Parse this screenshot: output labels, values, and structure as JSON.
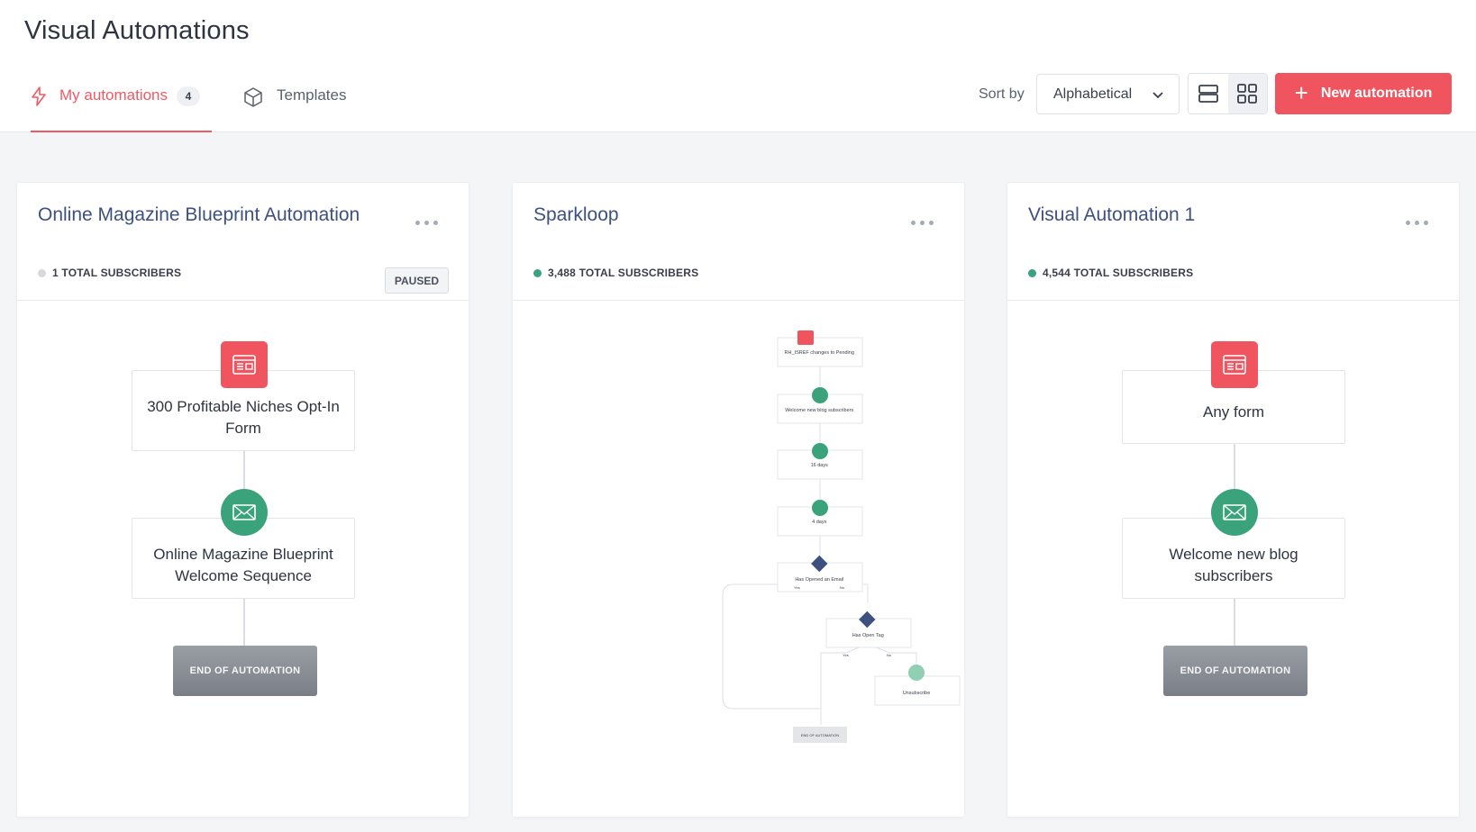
{
  "header": {
    "title": "Visual Automations",
    "tabs": [
      {
        "label": "My automations",
        "count": "4",
        "icon": "lightning-icon",
        "active": true
      },
      {
        "label": "Templates",
        "icon": "box-icon",
        "active": false
      }
    ],
    "sort_label": "Sort by",
    "sort_value": "Alphabetical",
    "view_modes": [
      "list-view-icon",
      "grid-view-icon"
    ],
    "active_view": "grid",
    "new_button": "New automation"
  },
  "colors": {
    "accent": "#f0555f",
    "active_dot": "#3aa37b",
    "inactive_dot": "#d5d8dd",
    "title": "#3d5080",
    "condition": "#3d5080"
  },
  "cards": [
    {
      "title": "Online Magazine Blueprint Automation",
      "subscribers": "1 TOTAL SUBSCRIBERS",
      "status_dot": "inactive",
      "badge": "PAUSED",
      "nodes": [
        {
          "type": "form",
          "icon": "form-icon",
          "label": "300 Profitable Niches Opt-In Form"
        },
        {
          "type": "email",
          "icon": "envelope-icon",
          "label": "Online Magazine Blueprint Welcome Sequence"
        }
      ],
      "end_label": "END OF AUTOMATION"
    },
    {
      "title": "Sparkloop",
      "subscribers": "3,488 TOTAL SUBSCRIBERS",
      "status_dot": "active",
      "flow": [
        {
          "type": "trigger",
          "icon": "tag-icon",
          "label": "RH_ISREF changes to Pending"
        },
        {
          "type": "email",
          "icon": "envelope-icon",
          "label": "Welcome new blog subscribers"
        },
        {
          "type": "delay",
          "icon": "clock-icon",
          "label": "16 days"
        },
        {
          "type": "delay",
          "icon": "clock-icon",
          "label": "4 days"
        },
        {
          "type": "condition",
          "icon": "branch-icon",
          "label": "Has Opened an Email"
        },
        {
          "type": "condition",
          "icon": "branch-icon",
          "label": "Has Open Tag"
        },
        {
          "type": "action",
          "icon": "unsubscribe-icon",
          "label": "Unsubscribe"
        }
      ],
      "branch_labels": {
        "yes": "Yes",
        "no": "No"
      },
      "end_label": "END OF AUTOMATION"
    },
    {
      "title": "Visual Automation 1",
      "subscribers": "4,544 TOTAL SUBSCRIBERS",
      "status_dot": "active",
      "nodes": [
        {
          "type": "form",
          "icon": "form-icon",
          "label": "Any form"
        },
        {
          "type": "email",
          "icon": "envelope-icon",
          "label": "Welcome new blog subscribers"
        }
      ],
      "end_label": "END OF AUTOMATION"
    }
  ]
}
